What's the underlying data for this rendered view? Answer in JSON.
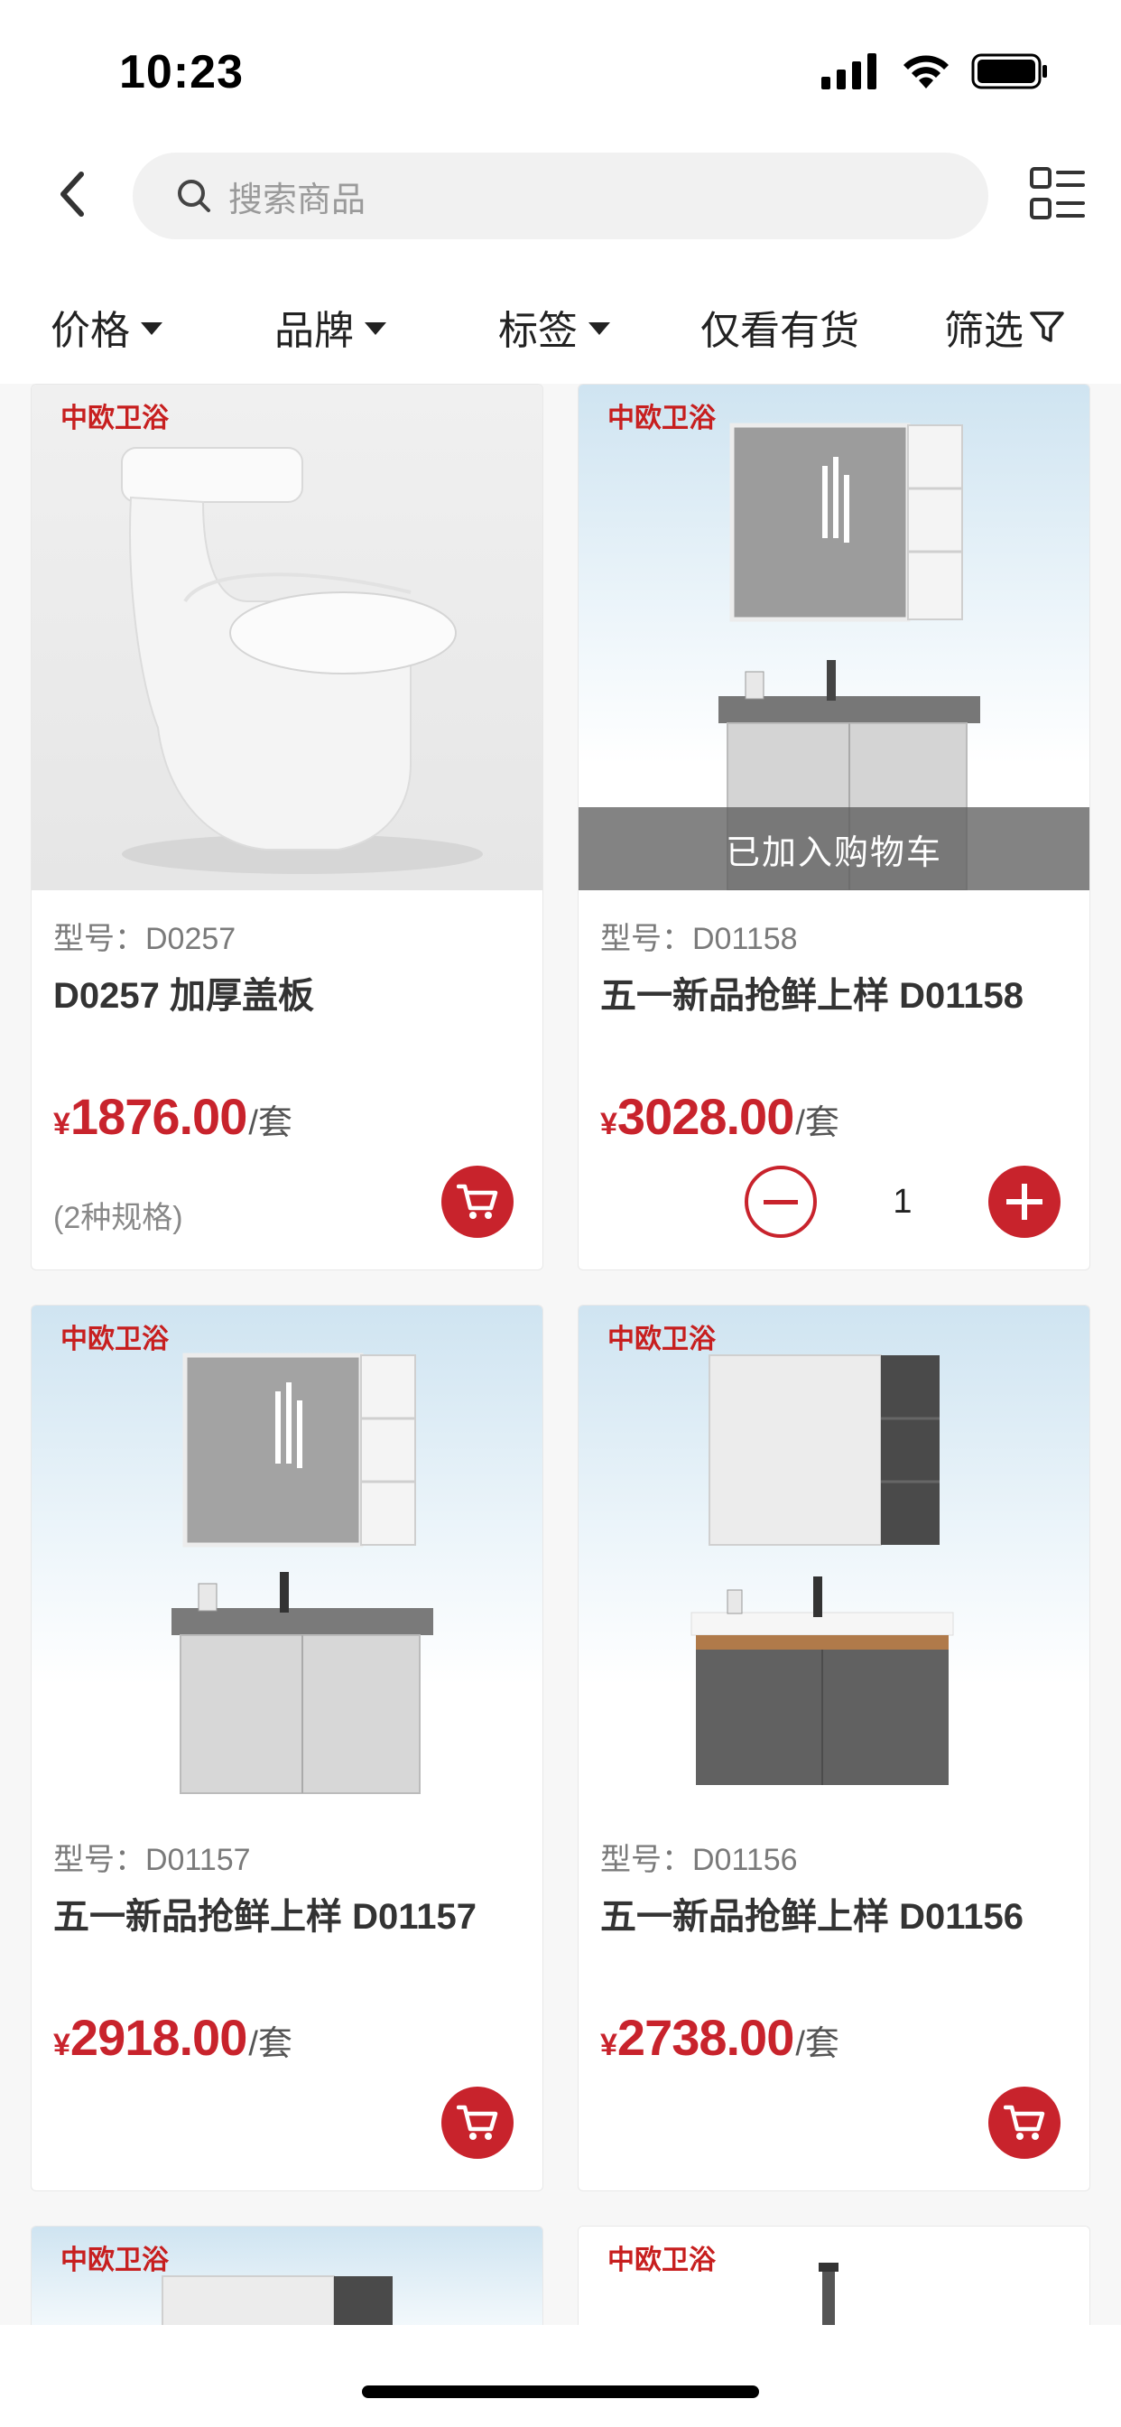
{
  "status_bar": {
    "time": "10:23"
  },
  "search": {
    "placeholder": "搜索商品"
  },
  "filters": [
    {
      "label": "价格",
      "has_caret": true
    },
    {
      "label": "品牌",
      "has_caret": true
    },
    {
      "label": "标签",
      "has_caret": true
    },
    {
      "label": "仅看有货",
      "has_caret": false
    },
    {
      "label": "筛选",
      "icon": "filter-icon"
    }
  ],
  "brand": {
    "logo_text": "中欧卫浴"
  },
  "products": [
    {
      "model_label": "型号：D0257",
      "title": "D0257 加厚盖板",
      "price_symbol": "¥",
      "price": "1876.00",
      "unit": "/套",
      "spec": "(2种规格)",
      "in_cart": false,
      "image": "toilet"
    },
    {
      "model_label": "型号：D01158",
      "title": "五一新品抢鲜上样 D01158",
      "price_symbol": "¥",
      "price": "3028.00",
      "unit": "/套",
      "spec": "",
      "in_cart": true,
      "overlay": "已加入购物车",
      "quantity": "1",
      "image": "cabinet-light"
    },
    {
      "model_label": "型号：D01157",
      "title": "五一新品抢鲜上样 D01157",
      "price_symbol": "¥",
      "price": "2918.00",
      "unit": "/套",
      "spec": "",
      "in_cart": false,
      "image": "cabinet-light"
    },
    {
      "model_label": "型号：D01156",
      "title": "五一新品抢鲜上样 D01156",
      "price_symbol": "¥",
      "price": "2738.00",
      "unit": "/套",
      "spec": "",
      "in_cart": false,
      "image": "cabinet-dark"
    }
  ],
  "colors": {
    "accent": "#c8232c",
    "brand_red": "#c71f1f"
  }
}
